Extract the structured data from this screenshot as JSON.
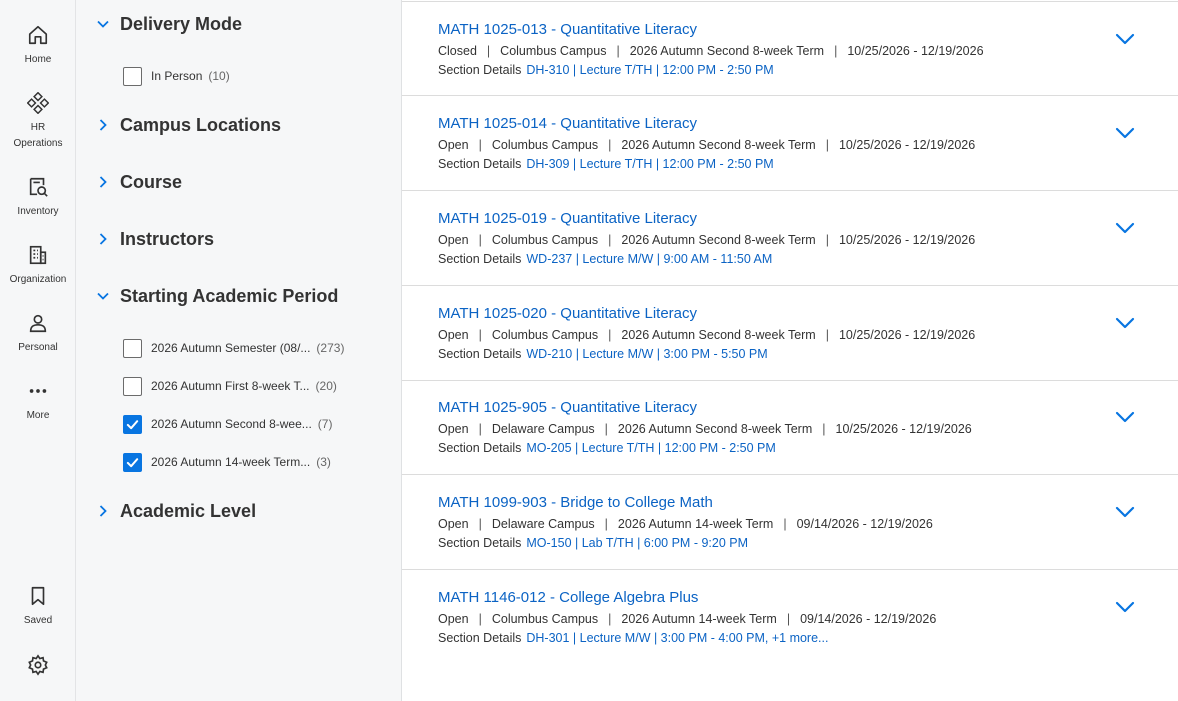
{
  "nav": {
    "items": [
      {
        "label": "Home"
      },
      {
        "label": "HR",
        "label2": "Operations"
      },
      {
        "label": "Inventory"
      },
      {
        "label": "Organization"
      },
      {
        "label": "Personal"
      },
      {
        "label": "More"
      }
    ],
    "saved_label": "Saved"
  },
  "filters": {
    "delivery_mode": {
      "title": "Delivery Mode",
      "options": [
        {
          "label": "In Person",
          "count": "(10)",
          "checked": false
        }
      ]
    },
    "campus_locations": {
      "title": "Campus Locations"
    },
    "course": {
      "title": "Course"
    },
    "instructors": {
      "title": "Instructors"
    },
    "starting_period": {
      "title": "Starting Academic Period",
      "options": [
        {
          "label": "2026 Autumn Semester (08/...",
          "count": "(273)",
          "checked": false
        },
        {
          "label": "2026 Autumn First 8-week T...",
          "count": "(20)",
          "checked": false
        },
        {
          "label": "2026 Autumn Second 8-wee...",
          "count": "(7)",
          "checked": true
        },
        {
          "label": "2026 Autumn 14-week Term...",
          "count": "(3)",
          "checked": true
        }
      ]
    },
    "academic_level": {
      "title": "Academic Level"
    }
  },
  "results": [
    {
      "title": "MATH 1025-013 - Quantitative Literacy",
      "status": "Closed",
      "campus": "Columbus Campus",
      "term": "2026 Autumn Second 8-week Term",
      "dates": "10/25/2026 - 12/19/2026",
      "details_label": "Section Details",
      "details": "DH-310 | Lecture T/TH | 12:00 PM - 2:50 PM"
    },
    {
      "title": "MATH 1025-014 - Quantitative Literacy",
      "status": "Open",
      "campus": "Columbus Campus",
      "term": "2026 Autumn Second 8-week Term",
      "dates": "10/25/2026 - 12/19/2026",
      "details_label": "Section Details",
      "details": "DH-309 | Lecture T/TH | 12:00 PM - 2:50 PM"
    },
    {
      "title": "MATH 1025-019 - Quantitative Literacy",
      "status": "Open",
      "campus": "Columbus Campus",
      "term": "2026 Autumn Second 8-week Term",
      "dates": "10/25/2026 - 12/19/2026",
      "details_label": "Section Details",
      "details": "WD-237 | Lecture M/W | 9:00 AM - 11:50 AM"
    },
    {
      "title": "MATH 1025-020 - Quantitative Literacy",
      "status": "Open",
      "campus": "Columbus Campus",
      "term": "2026 Autumn Second 8-week Term",
      "dates": "10/25/2026 - 12/19/2026",
      "details_label": "Section Details",
      "details": "WD-210 | Lecture M/W | 3:00 PM - 5:50 PM"
    },
    {
      "title": "MATH 1025-905 - Quantitative Literacy",
      "status": "Open",
      "campus": "Delaware Campus",
      "term": "2026 Autumn Second 8-week Term",
      "dates": "10/25/2026 - 12/19/2026",
      "details_label": "Section Details",
      "details": "MO-205 | Lecture T/TH | 12:00 PM - 2:50 PM"
    },
    {
      "title": "MATH 1099-903 - Bridge to College Math",
      "status": "Open",
      "campus": "Delaware Campus",
      "term": "2026 Autumn 14-week Term",
      "dates": "09/14/2026 - 12/19/2026",
      "details_label": "Section Details",
      "details": "MO-150 | Lab T/TH | 6:00 PM - 9:20 PM"
    },
    {
      "title": "MATH 1146-012 - College Algebra Plus",
      "status": "Open",
      "campus": "Columbus Campus",
      "term": "2026 Autumn 14-week Term",
      "dates": "09/14/2026 - 12/19/2026",
      "details_label": "Section Details",
      "details": "DH-301 | Lecture M/W | 3:00 PM - 4:00 PM, +1 more..."
    }
  ],
  "colors": {
    "accent": "#0875e1",
    "link": "#0b63c4"
  }
}
